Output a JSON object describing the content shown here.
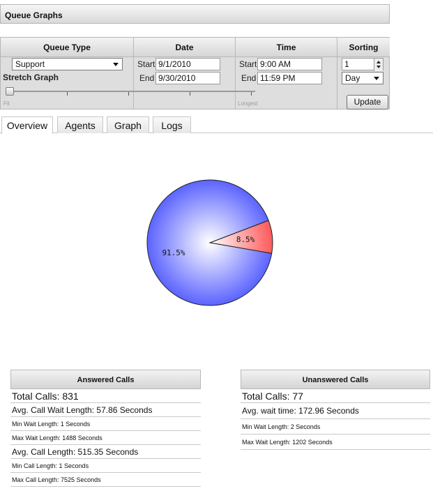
{
  "header": {
    "title": "Queue Graphs"
  },
  "controls": {
    "queue_type_label": "Queue Type",
    "queue_type_value": "Support",
    "stretch_label": "Stretch Graph",
    "slider_min_label": "Fit",
    "slider_max_label": "Longest",
    "slider_level": 0.0,
    "date_label": "Date",
    "time_label": "Time",
    "sorting_label": "Sorting",
    "start_label": "Start",
    "end_label": "End",
    "start_date": "9/1/2010",
    "end_date": "9/30/2010",
    "start_time": "9:00 AM",
    "end_time": "11:59 PM",
    "sort_number": "1",
    "sort_unit": "Day",
    "update_label": "Update"
  },
  "tabs": [
    {
      "label": "Overview",
      "active": true
    },
    {
      "label": "Agents",
      "active": false
    },
    {
      "label": "Graph",
      "active": false
    },
    {
      "label": "Logs",
      "active": false
    }
  ],
  "chart_data": {
    "type": "pie",
    "slices": [
      {
        "label": "91.5%",
        "value": 91.5,
        "color": "#5b63ff"
      },
      {
        "label": "8.5%",
        "value": 8.5,
        "color": "#ff5a5a"
      }
    ]
  },
  "answered": {
    "title": "Answered Calls",
    "total": "Total Calls: 831",
    "avg_wait": "Avg. Call Wait Length: 57.86 Seconds",
    "min_wait": "Min Wait Length: 1 Seconds",
    "max_wait": "Max Wait Length: 1488 Seconds",
    "avg_call": "Avg. Call Length: 515.35 Seconds",
    "min_call": "Min Call Length: 1 Seconds",
    "max_call": "Max Call Length: 7525 Seconds"
  },
  "unanswered": {
    "title": "Unanswered Calls",
    "total": "Total Calls: 77",
    "avg_wait": "Avg. wait time: 172.96 Seconds",
    "min_wait": "Min Wait Length: 2 Seconds",
    "max_wait": "Max Wait Length: 1202 Seconds"
  }
}
